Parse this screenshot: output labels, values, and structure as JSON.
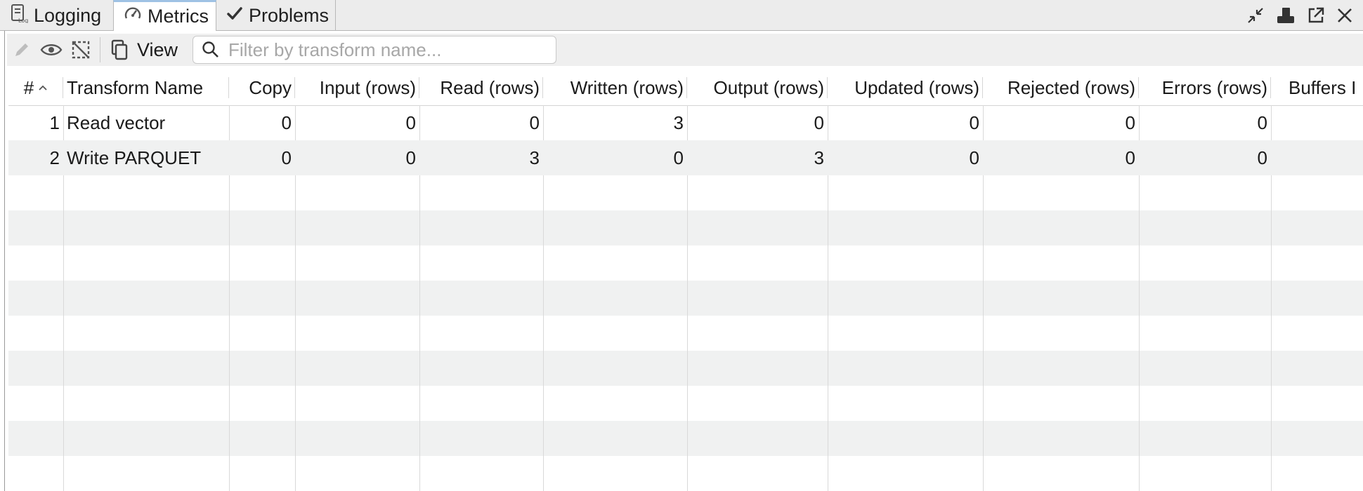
{
  "tabs": [
    {
      "label": "Logging",
      "icon": "log-icon"
    },
    {
      "label": "Metrics",
      "icon": "gauge-icon",
      "active": true
    },
    {
      "label": "Problems",
      "icon": "checkmark-icon"
    }
  ],
  "window_controls": [
    "minimize-icon",
    "restore-icon",
    "detach-icon",
    "close-icon"
  ],
  "toolbar": {
    "icons": [
      "edit-icon",
      "eye-icon",
      "select-all-icon",
      "copy-icon"
    ],
    "view_label": "View",
    "search_placeholder": "Filter by transform name..."
  },
  "table": {
    "columns": [
      "#",
      "Transform Name",
      "Copy",
      "Input (rows)",
      "Read (rows)",
      "Written (rows)",
      "Output (rows)",
      "Updated (rows)",
      "Rejected (rows)",
      "Errors (rows)",
      "Buffers I"
    ],
    "sort": {
      "column": "#",
      "direction": "ascending"
    },
    "rows": [
      [
        "1",
        "Read vector",
        "0",
        "0",
        "0",
        "3",
        "0",
        "0",
        "0",
        "0",
        ""
      ],
      [
        "2",
        "Write PARQUET",
        "0",
        "0",
        "3",
        "0",
        "3",
        "0",
        "0",
        "0",
        ""
      ]
    ]
  },
  "colors": {
    "tab_bar": "#ececec",
    "active_tab_accent": "#9fc2e4",
    "row_alt": "#f0f1f1",
    "grid_line": "#d9d9d9"
  }
}
